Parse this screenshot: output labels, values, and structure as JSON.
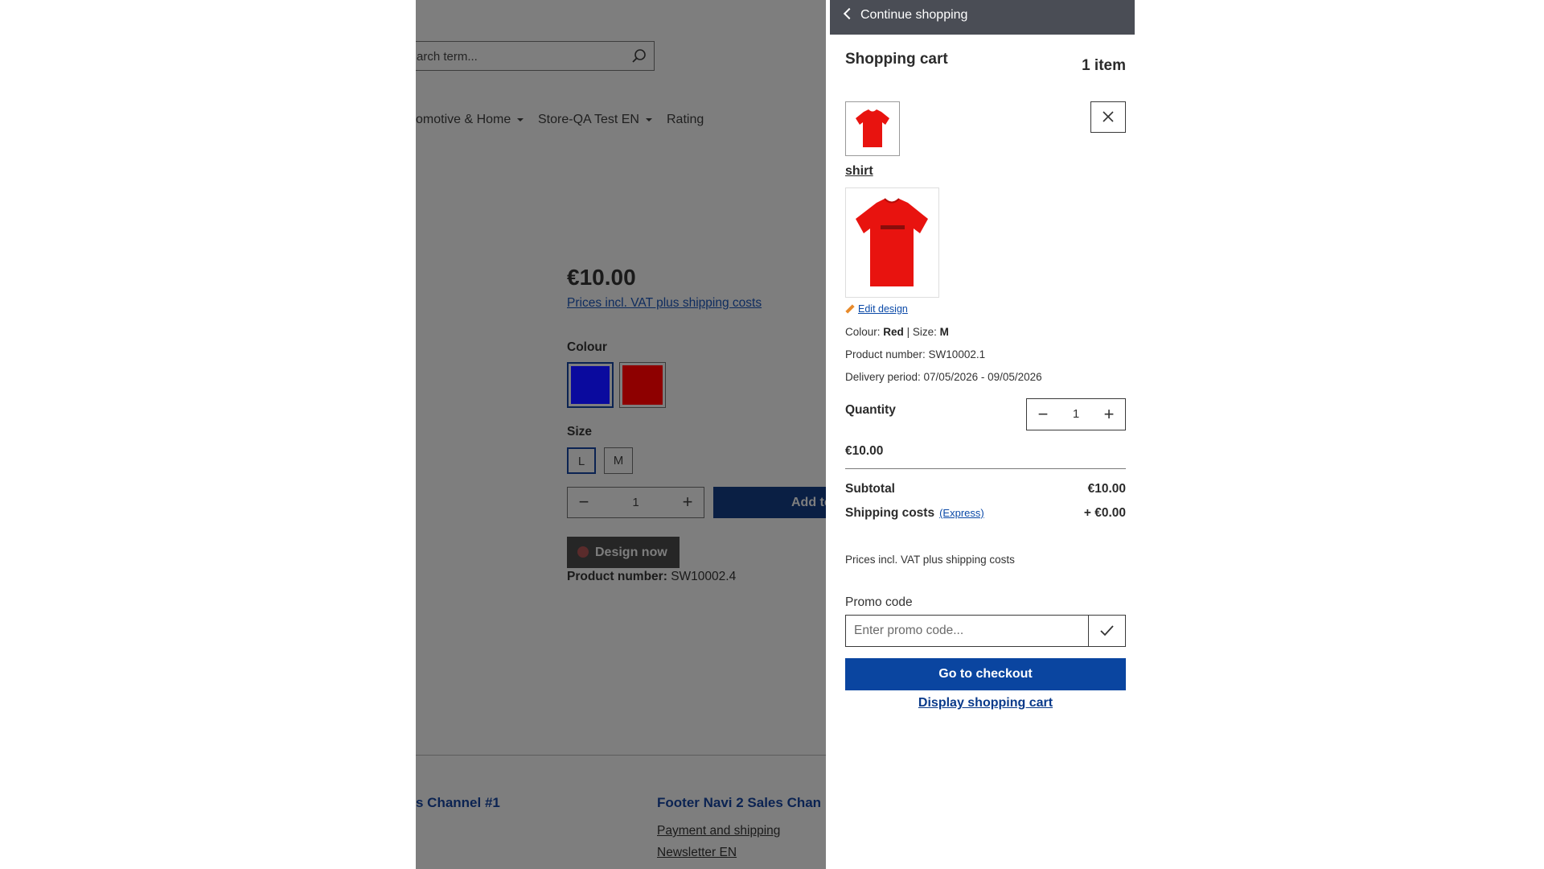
{
  "shop": {
    "search": {
      "placeholder": "arch term..."
    },
    "nav": [
      "omotive & Home",
      "Store-QA Test EN",
      "Rating"
    ],
    "product": {
      "price": "€10.00",
      "vat_link": "Prices incl. VAT plus shipping costs",
      "colour_label": "Colour",
      "colour_options": [
        "#0a0a9e",
        "#8e0000"
      ],
      "size_label": "Size",
      "sizes": [
        "L",
        "M"
      ],
      "quantity": "1",
      "add_button": "Add to",
      "design_button": "Design now",
      "product_number_label": "Product number:",
      "product_number": "SW10002.4"
    },
    "footer": {
      "col1_title": "s Channel #1",
      "col2_title": "Footer Navi 2 Sales Chan",
      "col2_links": [
        "Payment and shipping",
        "Newsletter EN"
      ]
    }
  },
  "cart": {
    "continue_label": "Continue shopping",
    "title": "Shopping cart",
    "count": "1 item",
    "item": {
      "name": "shirt",
      "edit_design": "Edit design",
      "colour_label": "Colour:",
      "colour": "Red",
      "size_label": "Size:",
      "size": "M",
      "product_number": "Product number: SW10002.1",
      "delivery": "Delivery period: 07/05/2026 - 09/05/2026",
      "quantity_label": "Quantity",
      "quantity": "1",
      "price": "€10.00",
      "image_color": "#e8130f"
    },
    "summary": {
      "subtotal_label": "Subtotal",
      "subtotal": "€10.00",
      "shipping_label": "Shipping costs",
      "shipping_method": "(Express)",
      "shipping": "+ €0.00"
    },
    "vat_note": "Prices incl. VAT plus shipping costs",
    "promo": {
      "label": "Promo code",
      "placeholder": "Enter promo code..."
    },
    "checkout_label": "Go to checkout",
    "display_cart_label": "Display shopping cart"
  },
  "colors": {
    "overlay": "#7e7e7e",
    "panel_header": "#4a4d55",
    "primary": "#0a45a0"
  }
}
